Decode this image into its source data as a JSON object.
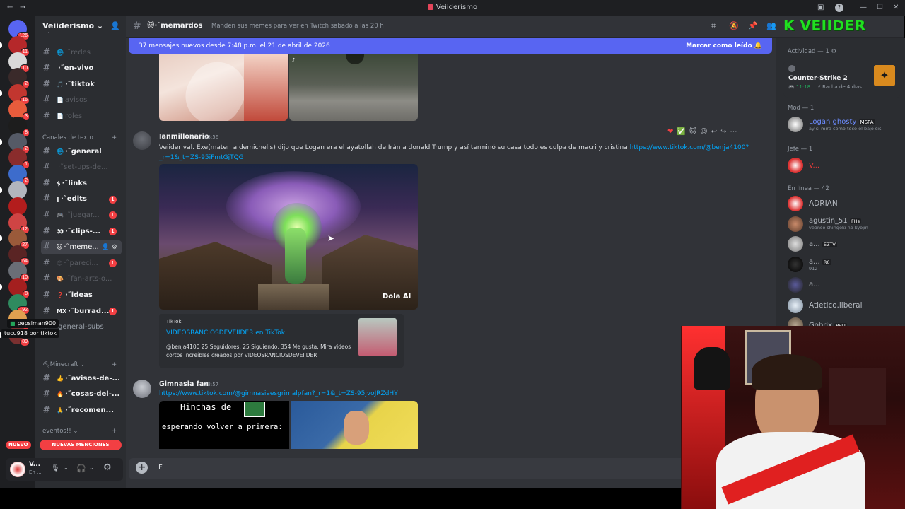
{
  "window": {
    "title": "Veiiderismo"
  },
  "servers": {
    "badges": [
      "126",
      "11",
      "10",
      "2",
      "16",
      "3",
      "8",
      "2",
      "1",
      "2",
      "",
      "",
      "12",
      "27",
      "64",
      "10",
      "8",
      "192",
      "145",
      "89"
    ],
    "new_label": "NUEVO"
  },
  "sidebar": {
    "server_name": "Veiiderismo",
    "channels_top": [
      {
        "name": "·˜redes"
      },
      {
        "name": "·˜en-vivo"
      },
      {
        "name": "·˜tiktok"
      },
      {
        "name": "avisos"
      },
      {
        "name": "roles"
      }
    ],
    "category_text": "Canales de texto",
    "channels_text": [
      {
        "name": "·˜general",
        "badge": ""
      },
      {
        "name": "·˜set-ups-de...",
        "badge": ""
      },
      {
        "name": "·˜links",
        "badge": ""
      },
      {
        "name": "·˜edits",
        "badge": "1"
      },
      {
        "name": "·˜juegar...",
        "badge": "1"
      },
      {
        "name": "·˜clips-...",
        "badge": "1"
      },
      {
        "name": "·˜meme...",
        "badge": ""
      },
      {
        "name": "·˜pareci...",
        "badge": "1"
      },
      {
        "name": "·˜fan-arts-o...",
        "badge": ""
      },
      {
        "name": "·˜ideas",
        "badge": ""
      },
      {
        "name": "·˜burrad...",
        "badge": "1"
      },
      {
        "name": "general-subs",
        "badge": ""
      }
    ],
    "voice_user": "pepsiman900",
    "stream_tooltip": "tucu918 por tiktok",
    "category_minecraft": "Minecraft",
    "channels_minecraft": [
      {
        "name": "·˜avisos-de-..."
      },
      {
        "name": "·˜cosas-del-..."
      },
      {
        "name": "·˜recomen..."
      }
    ],
    "category_events": "eventos!!",
    "new_mentions": "NUEVAS MENCIONES",
    "user_name": "V...",
    "user_status": "En ..."
  },
  "header": {
    "channel": "·˜memardos",
    "topic": "Manden sus memes para ver en Twitch sabado a las 20 h"
  },
  "banner": {
    "text": "37 mensajes nuevos desde 7:48 p.m. el 21 de abril de 2026",
    "action": "Marcar como leído"
  },
  "messages": [
    {
      "author": "Ianmillonario",
      "time": "23:56",
      "text": "Veiider val. Exe(maten a demichelis) dijo que Logan era el ayatollah de Irán a donald Trump y así terminó su casa todo es culpa de macri y cristina ",
      "link": "https://www.tiktok.com/@benja4100?_r=1&_t=ZS-95iFmtGjTQG",
      "image_caption": "Dola AI",
      "embed": {
        "provider": "TikTok",
        "title": "VIDEOSRANCIOSDEVEIIDER en TikTok",
        "description": "@benja4100 25 Seguidores, 25 Siguiendo, 354 Me gusta: Mira videos cortos increíbles creados por VIDEOSRANCIOSDEVEIIDER"
      }
    },
    {
      "author": "Gimnasia fan",
      "time": "23:57",
      "link": "https://www.tiktok.com/@gimnasiaesgrimalpfan?_r=1&_t=ZS-95jvoJRZdHY",
      "image_text_1": "Hinchas de",
      "image_text_2": "esperando volver a primera:"
    }
  ],
  "composer": {
    "value": "F"
  },
  "members": {
    "activity_header": "Actividad — 1",
    "activity_game": "Counter-Strike 2",
    "activity_time": "11:18",
    "activity_streak": "Racha de 4 días",
    "mod_header": "Mod — 1",
    "mod_name": "Logan ghosty",
    "mod_tag": "MSPA",
    "mod_status": "ay si mira como toco el bajo sisi",
    "jefe_header": "Jefe — 1",
    "jefe_name": "V...",
    "online_header": "En línea — 42",
    "online": [
      {
        "name": "ADRIAN",
        "tag": "",
        "status": ""
      },
      {
        "name": "agustin_51",
        "tag": "FHs",
        "status": "veanse shingeki no kyojin"
      },
      {
        "name": "a...",
        "tag": "EZTV",
        "status": ""
      },
      {
        "name": "a...",
        "tag": "R6",
        "status": "912"
      },
      {
        "name": "a...",
        "tag": "",
        "status": ""
      },
      {
        "name": "Atletico.liberal",
        "tag": "",
        "status": ""
      },
      {
        "name": "Gobrix",
        "tag": "PELI",
        "status": ""
      }
    ]
  },
  "overlay": {
    "logo": "K VEIIDER"
  },
  "colors": {
    "accent": "#5865f2",
    "link": "#00a8fc",
    "danger": "#f23f43",
    "online": "#23a55a"
  }
}
